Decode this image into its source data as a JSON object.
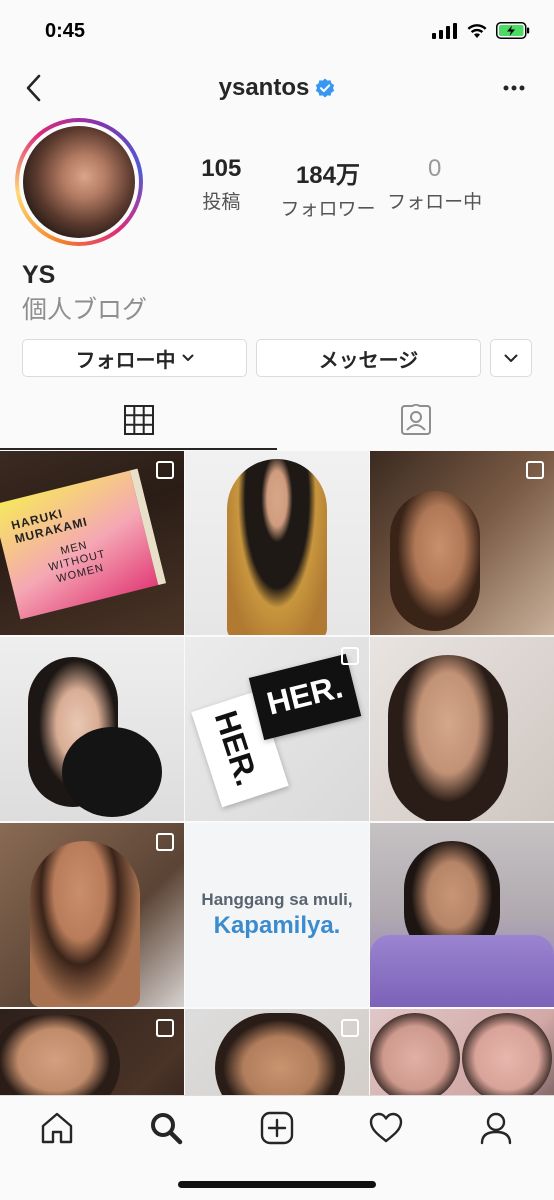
{
  "status_bar": {
    "time": "0:45",
    "icons": [
      "cellular-signal-icon",
      "wifi-icon",
      "battery-charging-icon"
    ],
    "battery_color": "#4cd964"
  },
  "header": {
    "username": "ysantos",
    "verified": true,
    "verified_color": "#3897f0",
    "back_icon": "chevron-left-icon",
    "more_icon": "more-horizontal-icon"
  },
  "profile": {
    "stats": [
      {
        "value": "105",
        "label": "投稿"
      },
      {
        "value": "184万",
        "label": "フォロワー"
      },
      {
        "value": "0",
        "label": "フォロー中"
      }
    ],
    "name": "YS",
    "category": "個人ブログ"
  },
  "actions": {
    "follow_label": "フォロー中",
    "message_label": "メッセージ"
  },
  "tabs": {
    "active": "grid",
    "items": [
      "grid-icon",
      "tagged-icon"
    ]
  },
  "grid": {
    "posts": [
      {
        "multi": true,
        "book_title": "HARUKI\nMURAKAMI",
        "book_subtitle": "MEN\nWITHOUT\nWOMEN"
      },
      {
        "multi": false
      },
      {
        "multi": true
      },
      {
        "multi": false
      },
      {
        "multi": true,
        "card_text_a": "HER.",
        "card_text_b": "HER."
      },
      {
        "multi": false
      },
      {
        "multi": true
      },
      {
        "multi": false,
        "caption_line1": "Hanggang sa muli,",
        "caption_line2": "Kapamilya."
      },
      {
        "multi": false
      },
      {
        "multi": true
      },
      {
        "multi": true
      },
      {
        "multi": false
      }
    ]
  },
  "bottom_nav": {
    "items": [
      "home-icon",
      "search-icon",
      "new-post-icon",
      "activity-heart-icon",
      "profile-icon"
    ],
    "active": "search-icon"
  }
}
